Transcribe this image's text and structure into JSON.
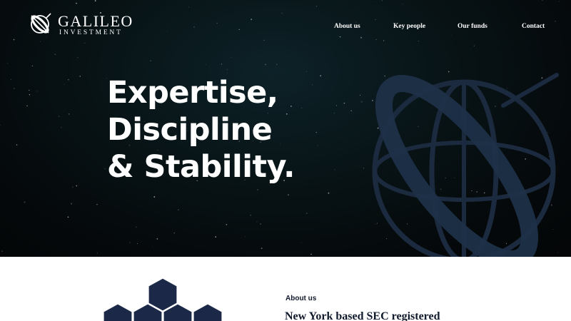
{
  "brand": {
    "name": "GALILEO",
    "subtitle": "INVESTMENT",
    "logo_icon": "galileo-orbit-icon"
  },
  "nav": {
    "items": [
      {
        "label": "About us"
      },
      {
        "label": "Key people"
      },
      {
        "label": "Our funds"
      },
      {
        "label": "Contact"
      }
    ]
  },
  "hero": {
    "headline_lines": [
      "Expertise,",
      "Discipline",
      "& Stability."
    ],
    "decoration_icon": "globe-orbit-icon"
  },
  "about": {
    "label": "About us",
    "title": "New York based SEC registered",
    "decoration_icon": "hexagon-cluster-icon"
  },
  "colors": {
    "hero_background": "#05090b",
    "globe_stroke": "#1b2a3f",
    "hexagon_fill": "#1c2848",
    "text_dark": "#111a2c",
    "text_light": "#ffffff"
  }
}
